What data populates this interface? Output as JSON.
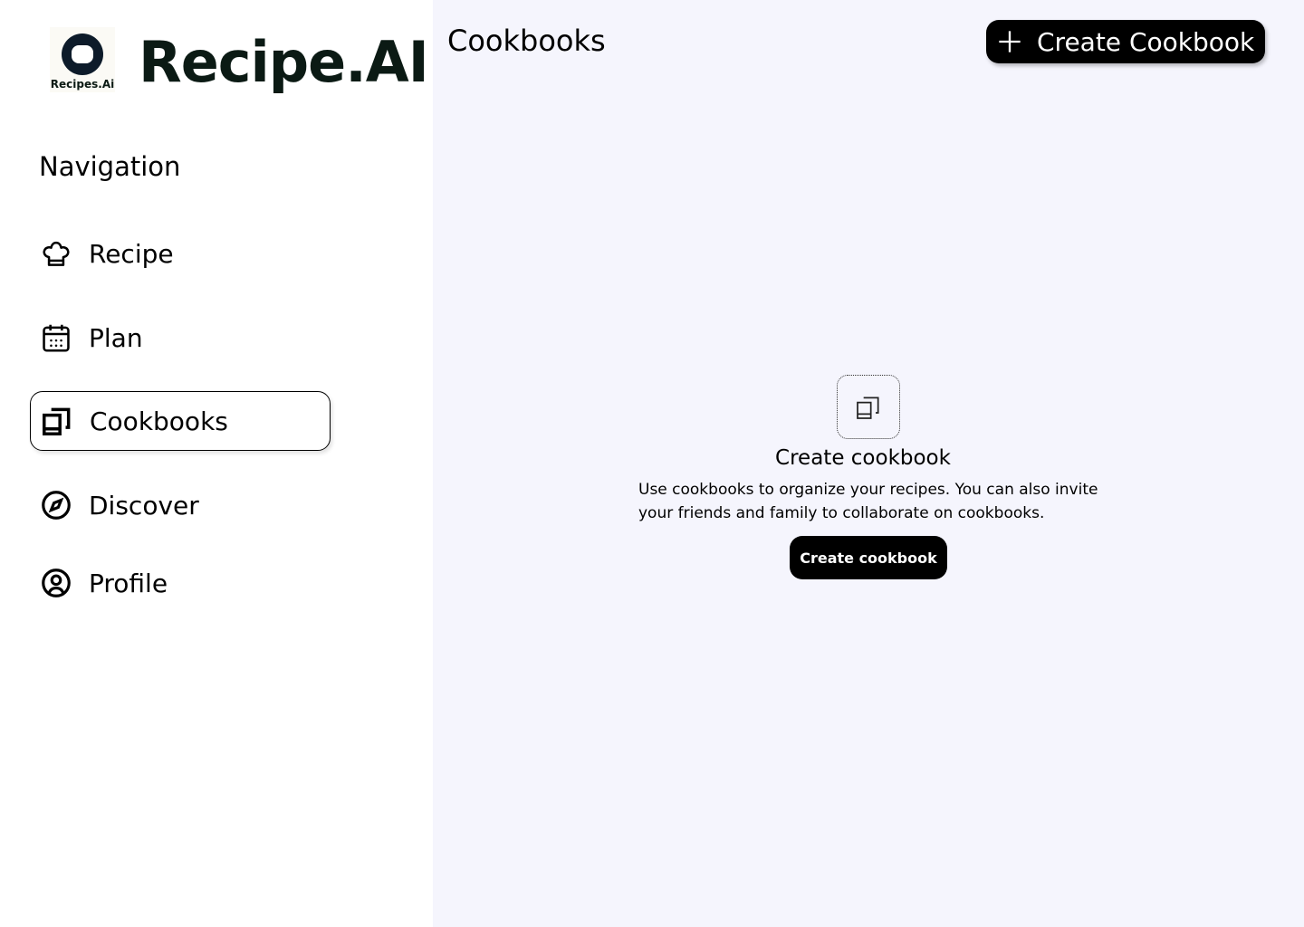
{
  "sidebar": {
    "logo_text": "Recipes.Ai",
    "brand": "Recipe.AI",
    "nav_title": "Navigation",
    "items": [
      {
        "label": "Recipe",
        "icon": "chef-hat-icon"
      },
      {
        "label": "Plan",
        "icon": "calendar-icon"
      },
      {
        "label": "Cookbooks",
        "icon": "cookbooks-icon",
        "active": true
      },
      {
        "label": "Discover",
        "icon": "compass-icon"
      },
      {
        "label": "Profile",
        "icon": "user-circle-icon"
      }
    ]
  },
  "header": {
    "title": "Cookbooks",
    "create_label": "Create Cookbook"
  },
  "empty_state": {
    "title": "Create cookbook",
    "description": "Use cookbooks to organize your recipes. You can also invite your friends and family to collaborate on cookbooks.",
    "button_label": "Create cookbook"
  },
  "colors": {
    "main_bg": "#f5f5fd",
    "button_bg": "#000000",
    "brand_text": "#0b1a14"
  }
}
